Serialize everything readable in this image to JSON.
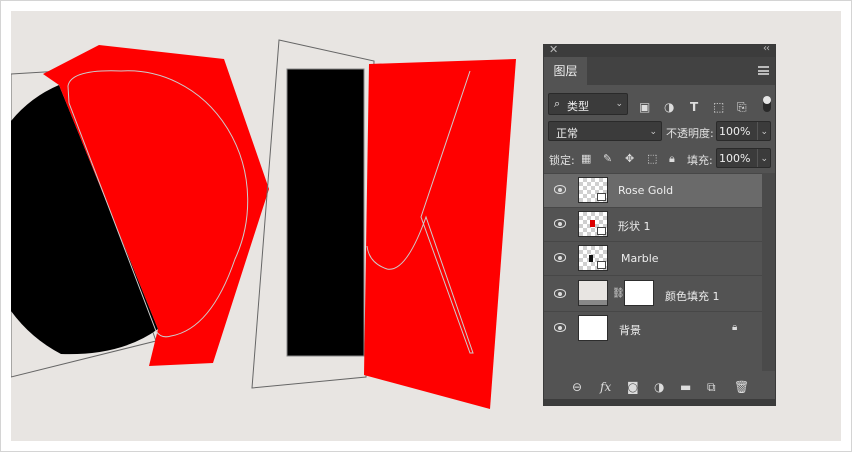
{
  "panel": {
    "close_icon": "✕",
    "collapse_icon": "‹‹",
    "tab_label": "图层",
    "filter": {
      "kind_label": "类型",
      "icons": [
        "image-filter-icon",
        "adjustment-filter-icon",
        "type-filter-icon",
        "shape-filter-icon",
        "smart-object-filter-icon"
      ]
    },
    "blend_mode": "正常",
    "opacity_label": "不透明度:",
    "opacity_value": "100%",
    "lock_label": "锁定:",
    "fill_label": "填充:",
    "fill_value": "100%",
    "layers": [
      {
        "name": "Rose Gold",
        "selected": true,
        "visible": true
      },
      {
        "name": "形状 1",
        "selected": false,
        "visible": true
      },
      {
        "name": "Marble",
        "selected": false,
        "visible": true
      },
      {
        "name": "颜色填充 1",
        "selected": false,
        "visible": true
      },
      {
        "name": "背景",
        "selected": false,
        "visible": true,
        "locked": true
      }
    ],
    "bottom_icons": [
      "link-layers-icon",
      "fx-icon",
      "add-mask-icon",
      "adjustment-layer-icon",
      "group-folder-icon",
      "new-layer-icon",
      "trash-icon"
    ],
    "fx_label": "fx"
  },
  "colors": {
    "canvas_bg": "#e8e5e2",
    "shape_red": "#ff0000",
    "shape_black": "#000000",
    "panel_bg": "#535353"
  }
}
